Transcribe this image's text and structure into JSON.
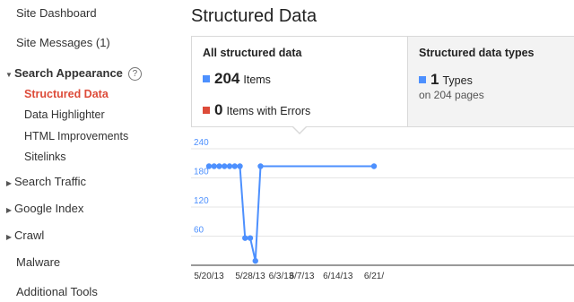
{
  "sidebar": {
    "items": [
      {
        "label": "Site Dashboard"
      },
      {
        "label": "Site Messages (1)"
      },
      {
        "label": "Search Appearance"
      },
      {
        "label": "Structured Data"
      },
      {
        "label": "Data Highlighter"
      },
      {
        "label": "HTML Improvements"
      },
      {
        "label": "Sitelinks"
      },
      {
        "label": "Search Traffic"
      },
      {
        "label": "Google Index"
      },
      {
        "label": "Crawl"
      },
      {
        "label": "Malware"
      },
      {
        "label": "Additional Tools"
      }
    ],
    "help_glyph": "?"
  },
  "main": {
    "title": "Structured Data",
    "summary": {
      "all": {
        "title": "All structured data",
        "items_count": "204",
        "items_label": "Items",
        "errors_count": "0",
        "errors_label": "Items with Errors"
      },
      "types": {
        "title": "Structured data types",
        "types_count": "1",
        "types_label": "Types",
        "pages_text": "on 204 pages"
      }
    }
  },
  "colors": {
    "accent_blue": "#4d90fe",
    "error_red": "#dd4b39",
    "active_nav": "#dd4b39"
  },
  "chart_data": {
    "type": "line",
    "y_ticks": [
      240,
      180,
      120,
      60
    ],
    "x_tick_labels": [
      "5/20/13",
      "5/28/13",
      "6/3/13",
      "6/7/13",
      "6/14/13",
      "6/21/"
    ],
    "x_tick_dates": [
      "2013-05-20",
      "2013-05-28",
      "2013-06-03",
      "2013-06-07",
      "2013-06-14",
      "2013-06-21"
    ],
    "ylim": [
      0,
      240
    ],
    "grid": true,
    "series": [
      {
        "x": [
          "2013-05-20",
          "2013-05-21",
          "2013-05-22",
          "2013-05-23",
          "2013-05-24",
          "2013-05-25",
          "2013-05-26",
          "2013-05-27",
          "2013-05-28",
          "2013-05-29",
          "2013-05-30",
          "2013-06-21"
        ],
        "values": [
          204,
          204,
          204,
          204,
          204,
          204,
          204,
          56,
          56,
          9,
          204,
          204
        ]
      }
    ]
  }
}
